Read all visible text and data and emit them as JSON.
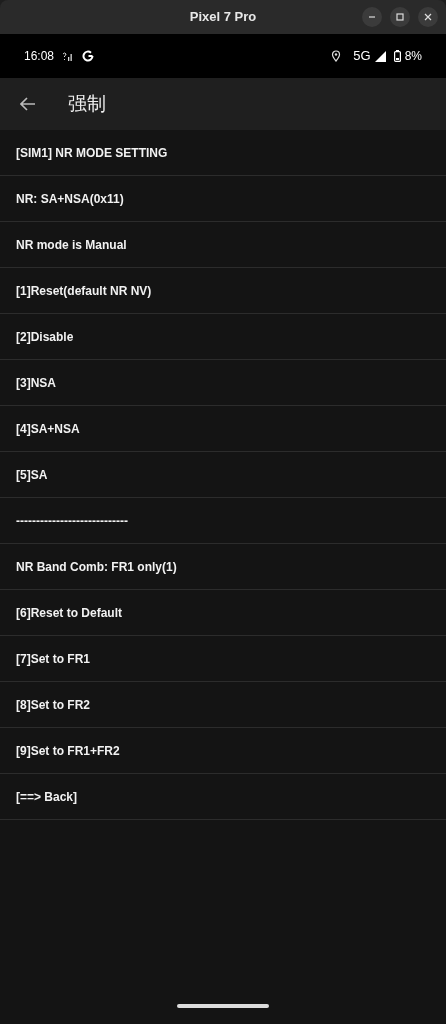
{
  "window": {
    "title": "Pixel 7 Pro"
  },
  "status_bar": {
    "time": "16:08",
    "network": "5G",
    "battery": "8%"
  },
  "app_bar": {
    "title": "强制"
  },
  "items": [
    "[SIM1] NR MODE SETTING",
    "NR: SA+NSA(0x11)",
    "NR mode is Manual",
    "[1]Reset(default NR NV)",
    "[2]Disable",
    "[3]NSA",
    "[4]SA+NSA",
    "[5]SA",
    "----------------------------",
    "NR Band Comb: FR1 only(1)",
    "[6]Reset to Default",
    "[7]Set to FR1",
    "[8]Set to FR2",
    "[9]Set to FR1+FR2",
    "[==> Back]"
  ]
}
